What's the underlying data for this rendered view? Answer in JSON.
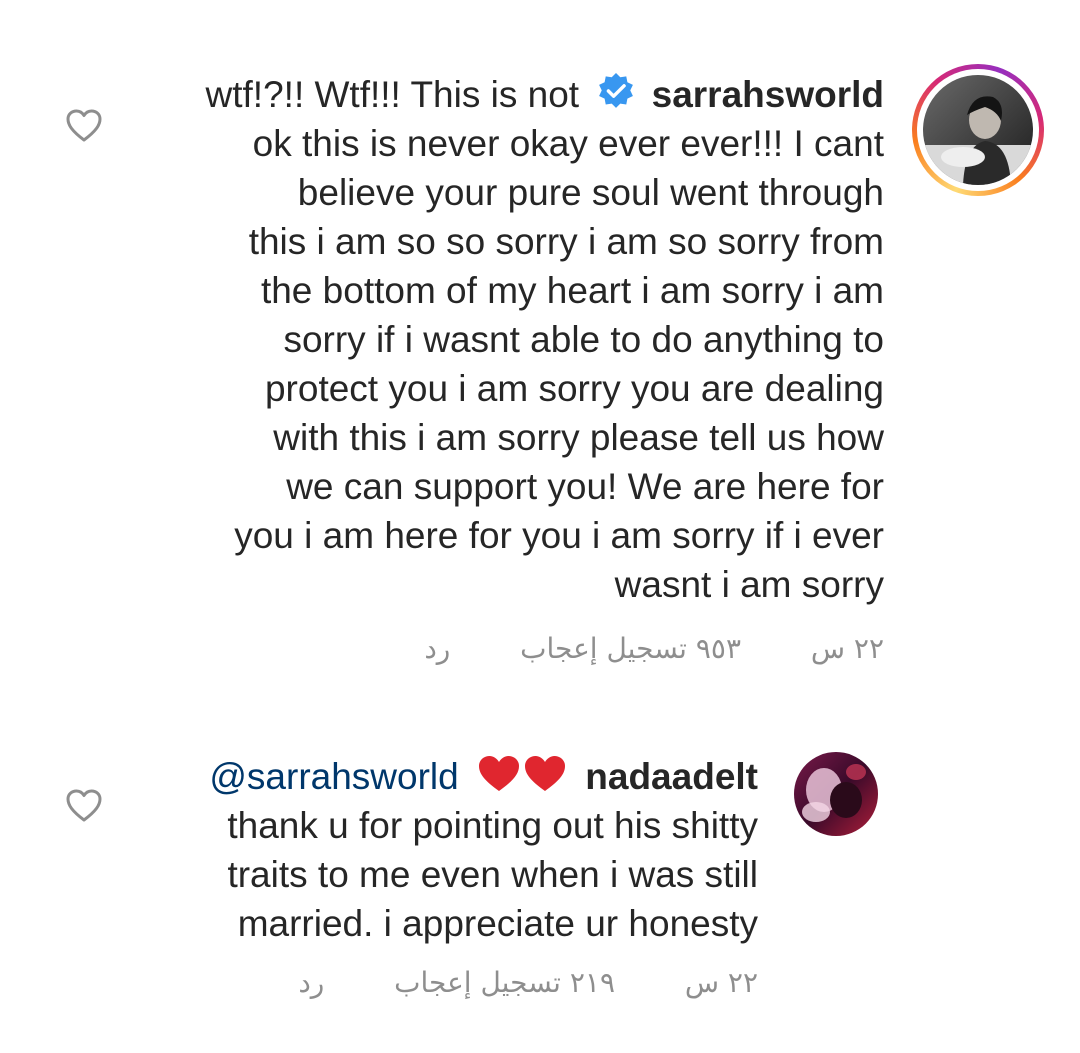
{
  "comments": [
    {
      "username": "sarrahsworld",
      "verified": true,
      "lines": [
        "wtf!?!! Wtf!!! This is not",
        "ok this is never okay ever ever!!! I cant",
        "believe your pure soul went through",
        "this i am so so sorry i am so sorry from",
        "the bottom of my heart i am sorry i am",
        "sorry if i wasnt able to do anything to",
        "protect you i am sorry you are dealing",
        "with this i am sorry please tell us how",
        "we can support you! We are here for",
        "you i am here for you i am sorry if i ever",
        "wasnt i am sorry"
      ],
      "time": "٢٢ س",
      "likes": "٩٥٣ تسجيل إعجاب",
      "reply": "رد",
      "avatar_icon": "profile-photo"
    },
    {
      "username": "nadaadelt",
      "verified": false,
      "mention": "@sarrahsworld",
      "emoji": "❤❤",
      "lines": [
        "thank u for pointing out his shitty",
        "traits to me even when i was still",
        "married. i appreciate ur honesty"
      ],
      "time": "٢٢ س",
      "likes": "٢١٩ تسجيل إعجاب",
      "reply": "رد",
      "avatar_icon": "profile-photo"
    }
  ],
  "colors": {
    "text": "#262626",
    "meta": "#8e8e8e",
    "mention": "#00376b",
    "verified": "#3897f0",
    "heart_red": "#ed4956"
  },
  "icons": {
    "like": "heart-outline-icon",
    "verified": "verified-badge-icon"
  }
}
